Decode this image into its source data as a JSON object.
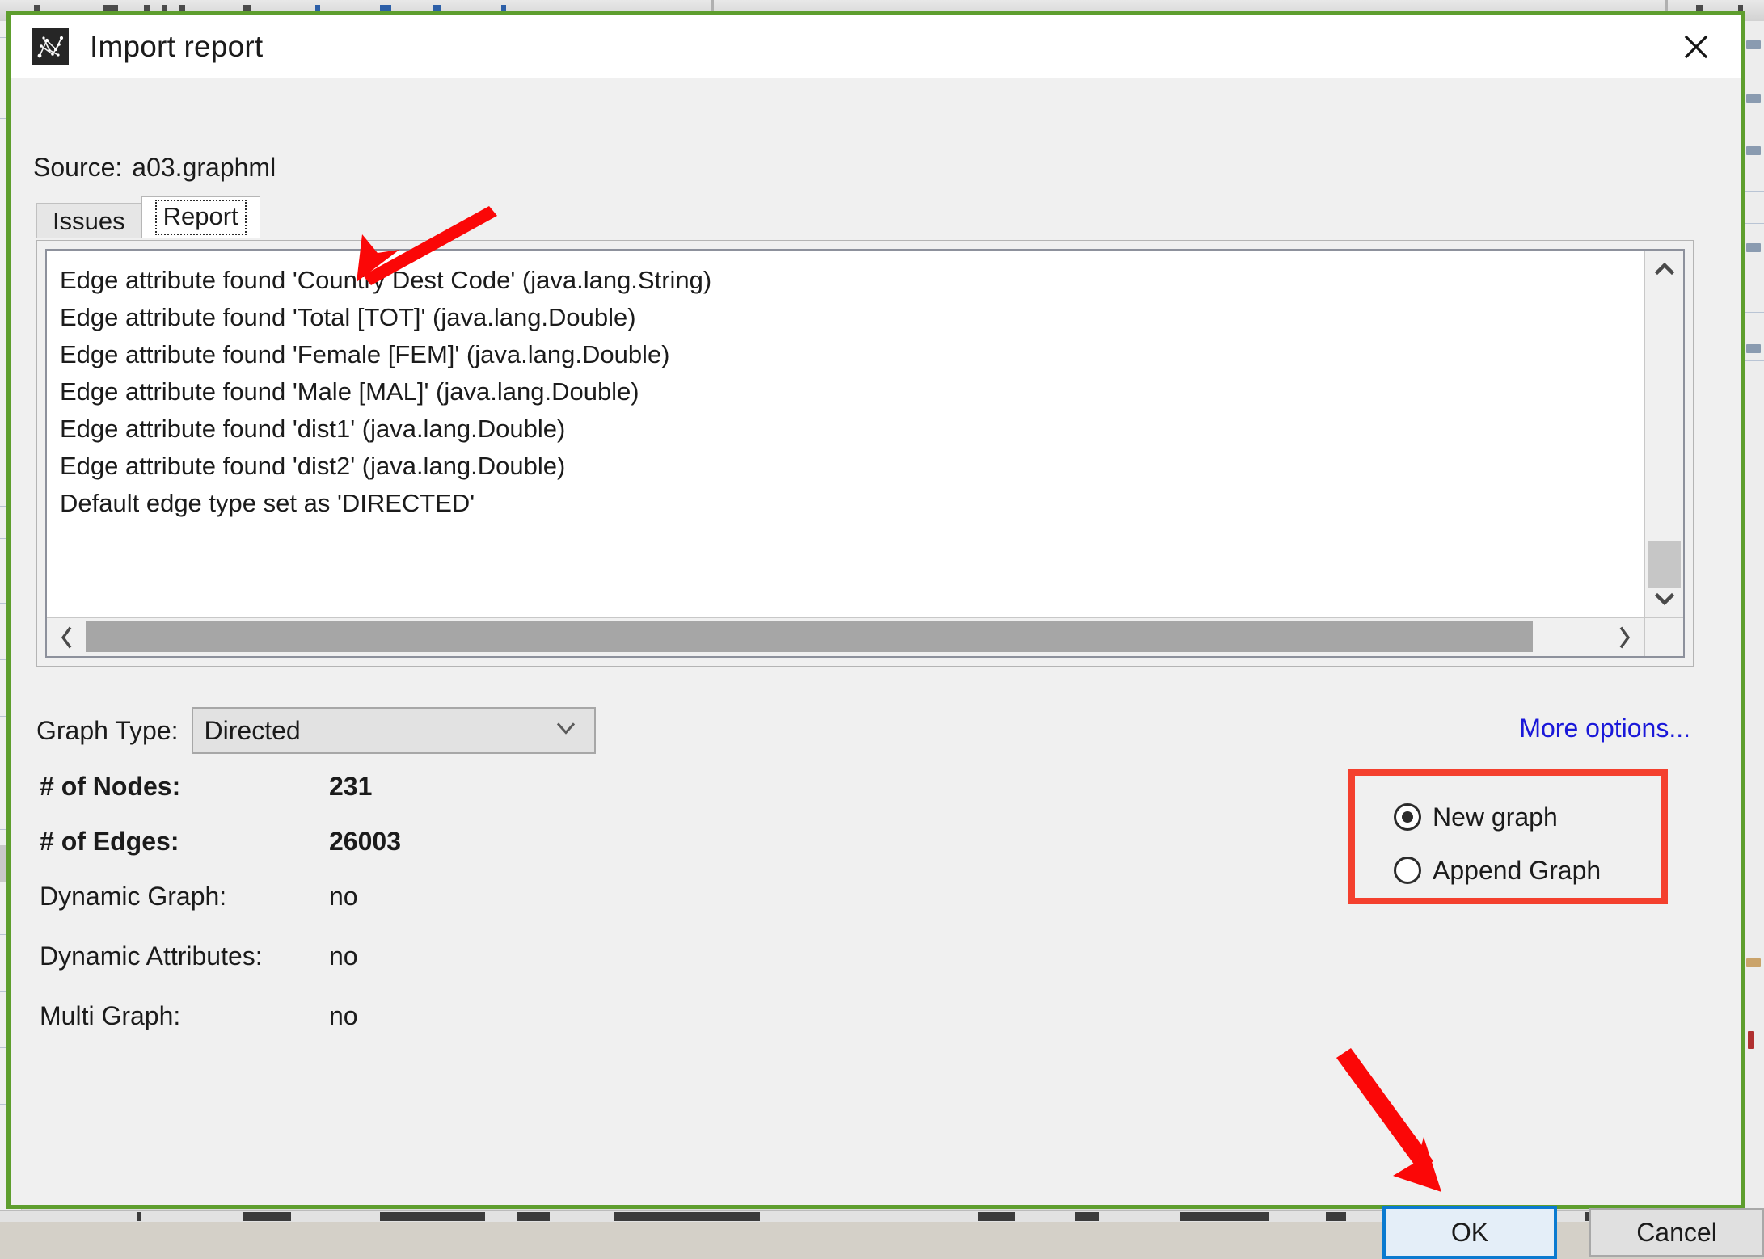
{
  "window": {
    "title": "Import report",
    "icon": "gephi-logo-icon",
    "close_label": "Close"
  },
  "source": {
    "label": "Source:",
    "value": "a03.graphml"
  },
  "tabs": [
    {
      "label": "Issues",
      "active": false
    },
    {
      "label": "Report",
      "active": true
    }
  ],
  "report": {
    "lines": [
      "Edge attribute found 'Country Dest Code' (java.lang.String)",
      "Edge attribute found 'Total [TOT]' (java.lang.Double)",
      "Edge attribute found 'Female [FEM]' (java.lang.Double)",
      "Edge attribute found 'Male [MAL]' (java.lang.Double)",
      "Edge attribute found 'dist1' (java.lang.Double)",
      "Edge attribute found 'dist2' (java.lang.Double)",
      "Default edge type set as 'DIRECTED'"
    ],
    "scroll_up_icon": "chevron-up-icon",
    "scroll_down_icon": "chevron-down-icon",
    "scroll_left_icon": "chevron-left-icon",
    "scroll_right_icon": "chevron-right-icon"
  },
  "graph_type": {
    "label": "Graph Type:",
    "value": "Directed",
    "caret_icon": "chevron-down-icon"
  },
  "more_options": {
    "label": "More options...",
    "color": "#1a18d9"
  },
  "stats": [
    {
      "label": "# of Nodes:",
      "value": "231",
      "bold": true
    },
    {
      "label": "# of Edges:",
      "value": "26003",
      "bold": true
    },
    {
      "label": "Dynamic Graph:",
      "value": "no",
      "bold": false
    },
    {
      "label": "Dynamic Attributes:",
      "value": "no",
      "bold": false
    },
    {
      "label": "Multi Graph:",
      "value": "no",
      "bold": false
    }
  ],
  "import_mode": {
    "options": [
      {
        "label": "New graph",
        "selected": true
      },
      {
        "label": "Append Graph",
        "selected": false
      }
    ],
    "highlight_color": "#f4402e"
  },
  "footer": {
    "ok_label": "OK",
    "cancel_label": "Cancel",
    "ok_focus_color": "#0a7ad0"
  },
  "annotations": {
    "arrow_color": "#fb0707",
    "arrows": [
      {
        "name": "arrow-to-report-tab"
      },
      {
        "name": "arrow-to-ok-button"
      }
    ]
  }
}
